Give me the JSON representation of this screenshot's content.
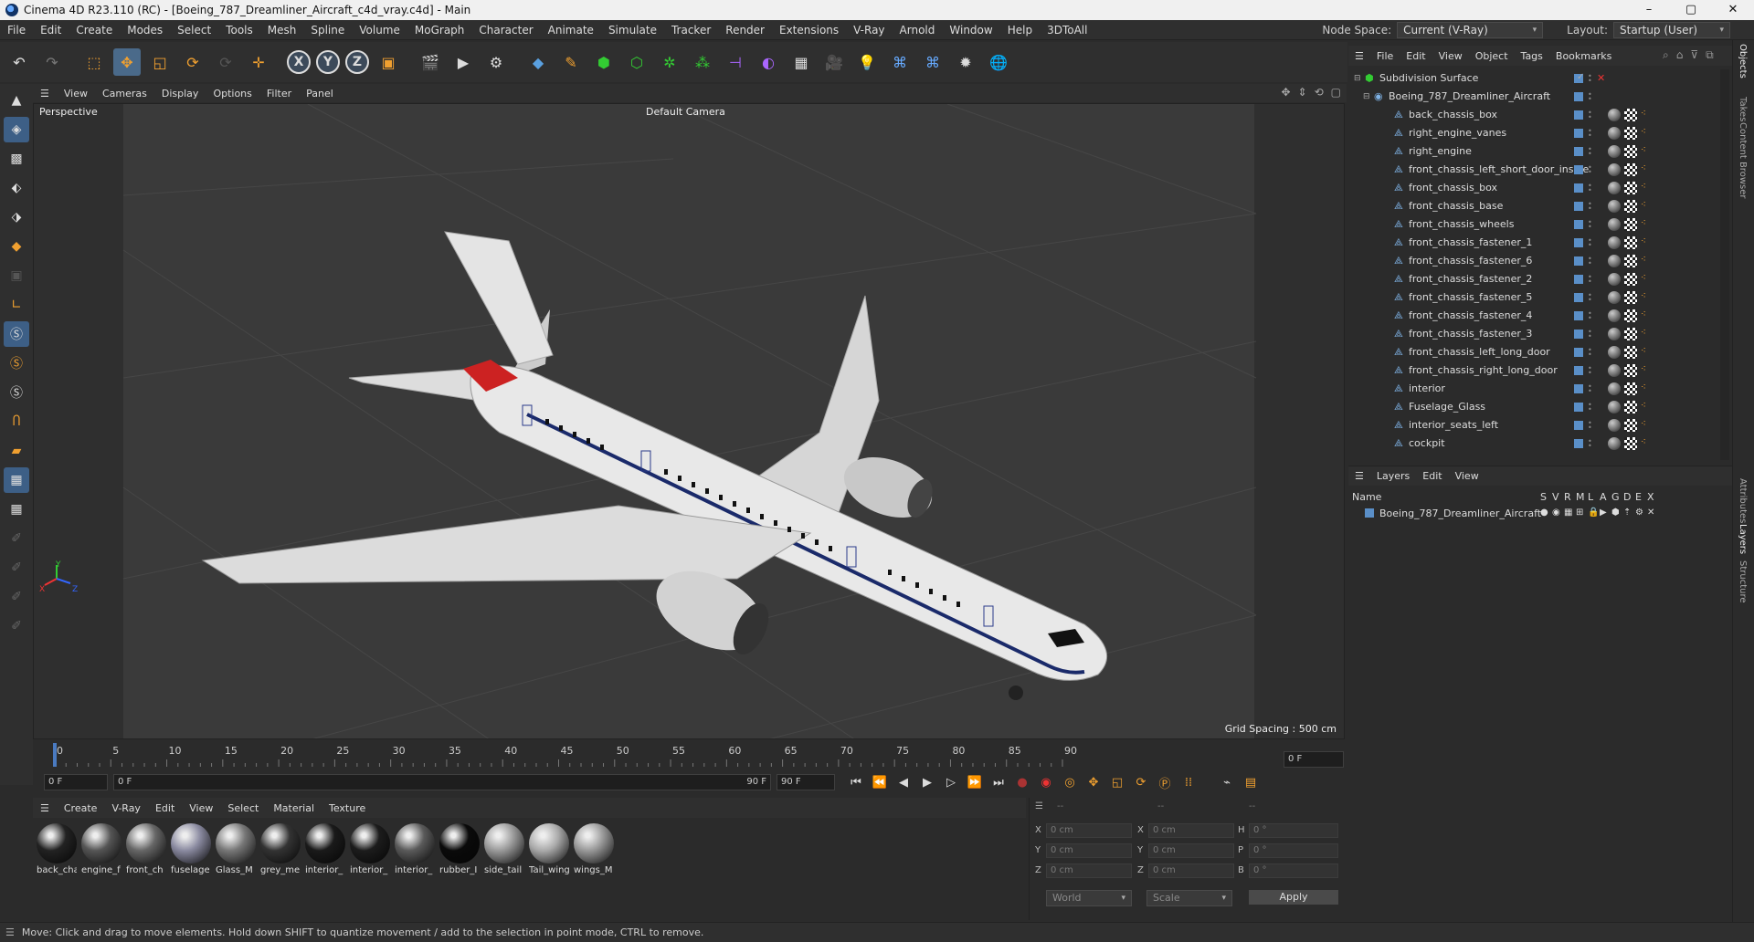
{
  "window": {
    "title": "Cinema 4D R23.110 (RC) - [Boeing_787_Dreamliner_Aircraft_c4d_vray.c4d] - Main",
    "controls": [
      "–",
      "▢",
      "✕"
    ]
  },
  "menubar": {
    "items": [
      "File",
      "Edit",
      "Create",
      "Modes",
      "Select",
      "Tools",
      "Mesh",
      "Spline",
      "Volume",
      "MoGraph",
      "Character",
      "Animate",
      "Simulate",
      "Tracker",
      "Render",
      "Extensions",
      "V-Ray",
      "Arnold",
      "Window",
      "Help",
      "3DToAll"
    ],
    "node_space_label": "Node Space:",
    "node_space_value": "Current (V-Ray)",
    "layout_label": "Layout:",
    "layout_value": "Startup (User)"
  },
  "viewport": {
    "menu": [
      "View",
      "Cameras",
      "Display",
      "Options",
      "Filter",
      "Panel"
    ],
    "view_name": "Perspective",
    "camera": "Default Camera",
    "grid_spacing": "Grid Spacing : 500 cm",
    "axis_labels": [
      "Y",
      "X",
      "Z"
    ]
  },
  "timeline": {
    "ticks": [
      "0",
      "5",
      "10",
      "15",
      "20",
      "25",
      "30",
      "35",
      "40",
      "45",
      "50",
      "55",
      "60",
      "65",
      "70",
      "75",
      "80",
      "85",
      "90"
    ],
    "current_frame_right": "0 F",
    "start_field": "0 F",
    "range_start": "0 F",
    "range_end": "90 F",
    "end_field": "90 F"
  },
  "materials": {
    "menu": [
      "Create",
      "V-Ray",
      "Edit",
      "View",
      "Select",
      "Material",
      "Texture"
    ],
    "items": [
      {
        "label": "back_cha",
        "color": "#222"
      },
      {
        "label": "engine_f",
        "color": "#555"
      },
      {
        "label": "front_ch",
        "color": "#666"
      },
      {
        "label": "fuselage",
        "color": "#8a8aa0"
      },
      {
        "label": "Glass_M",
        "color": "#777"
      },
      {
        "label": "grey_me",
        "color": "#333"
      },
      {
        "label": "interior_",
        "color": "#1a1a1a"
      },
      {
        "label": "interior_",
        "color": "#1c1c1c"
      },
      {
        "label": "interior_",
        "color": "#5a5a5a"
      },
      {
        "label": "rubber_I",
        "color": "#0a0a0a"
      },
      {
        "label": "side_tail",
        "color": "#9a9a9a"
      },
      {
        "label": "Tail_wing",
        "color": "#aaa"
      },
      {
        "label": "wings_M",
        "color": "#999"
      }
    ]
  },
  "coordinates": {
    "header": [
      "--",
      "--",
      "--"
    ],
    "rows": [
      {
        "a": "X",
        "av": "0 cm",
        "b": "X",
        "bv": "0 cm",
        "c": "H",
        "cv": "0 °"
      },
      {
        "a": "Y",
        "av": "0 cm",
        "b": "Y",
        "bv": "0 cm",
        "c": "P",
        "cv": "0 °"
      },
      {
        "a": "Z",
        "av": "0 cm",
        "b": "Z",
        "bv": "0 cm",
        "c": "B",
        "cv": "0 °"
      }
    ],
    "world": "World",
    "scale": "Scale",
    "apply": "Apply"
  },
  "objects": {
    "menu": [
      "File",
      "Edit",
      "View",
      "Object",
      "Tags",
      "Bookmarks"
    ],
    "items": [
      {
        "name": "Subdivision Surface",
        "level": 0
      },
      {
        "name": "Boeing_787_Dreamliner_Aircraft",
        "level": 1
      },
      {
        "name": "back_chassis_box",
        "level": 2
      },
      {
        "name": "right_engine_vanes",
        "level": 2
      },
      {
        "name": "right_engine",
        "level": 2
      },
      {
        "name": "front_chassis_left_short_door_inside",
        "level": 2
      },
      {
        "name": "front_chassis_box",
        "level": 2
      },
      {
        "name": "front_chassis_base",
        "level": 2
      },
      {
        "name": "front_chassis_wheels",
        "level": 2
      },
      {
        "name": "front_chassis_fastener_1",
        "level": 2
      },
      {
        "name": "front_chassis_fastener_6",
        "level": 2
      },
      {
        "name": "front_chassis_fastener_2",
        "level": 2
      },
      {
        "name": "front_chassis_fastener_5",
        "level": 2
      },
      {
        "name": "front_chassis_fastener_4",
        "level": 2
      },
      {
        "name": "front_chassis_fastener_3",
        "level": 2
      },
      {
        "name": "front_chassis_left_long_door",
        "level": 2
      },
      {
        "name": "front_chassis_right_long_door",
        "level": 2
      },
      {
        "name": "interior",
        "level": 2
      },
      {
        "name": "Fuselage_Glass",
        "level": 2
      },
      {
        "name": "interior_seats_left",
        "level": 2
      },
      {
        "name": "cockpit",
        "level": 2
      }
    ]
  },
  "layers": {
    "menu": [
      "Layers",
      "Edit",
      "View"
    ],
    "columns": [
      "Name",
      "S",
      "V",
      "R",
      "M",
      "L",
      "A",
      "G",
      "D",
      "E",
      "X"
    ],
    "items": [
      {
        "name": "Boeing_787_Dreamliner_Aircraft"
      }
    ]
  },
  "right_tabs": [
    "Objects",
    "Takes",
    "Content Browser",
    "Attributes",
    "Layers",
    "Structure"
  ],
  "status": "Move: Click and drag to move elements. Hold down SHIFT to quantize movement / add to the selection in point mode, CTRL to remove."
}
